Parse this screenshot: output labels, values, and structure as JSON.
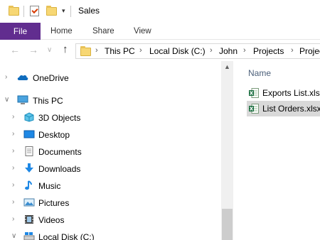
{
  "window": {
    "title": "Sales"
  },
  "quick_access": {
    "icons": [
      "folder-icon",
      "properties-icon",
      "new-folder-icon"
    ],
    "dropdown_glyph": "▾"
  },
  "ribbon": {
    "tabs": [
      "File",
      "Home",
      "Share",
      "View"
    ],
    "file_color": "#612d8f"
  },
  "nav": {
    "back": "←",
    "forward": "→",
    "recent": "∨",
    "up": "↑",
    "breadcrumb": [
      "This PC",
      "Local Disk (C:)",
      "John",
      "Projects",
      "Projec"
    ]
  },
  "tree": [
    {
      "label": "OneDrive",
      "icon": "onedrive-icon",
      "expander": "›"
    },
    {
      "label": "This PC",
      "icon": "computer-icon",
      "expander": "∨"
    },
    {
      "label": "3D Objects",
      "icon": "3d-objects-icon",
      "expander": "›"
    },
    {
      "label": "Desktop",
      "icon": "desktop-icon",
      "expander": "›"
    },
    {
      "label": "Documents",
      "icon": "documents-icon",
      "expander": "›"
    },
    {
      "label": "Downloads",
      "icon": "downloads-icon",
      "expander": "›"
    },
    {
      "label": "Music",
      "icon": "music-icon",
      "expander": "›"
    },
    {
      "label": "Pictures",
      "icon": "pictures-icon",
      "expander": "›"
    },
    {
      "label": "Videos",
      "icon": "videos-icon",
      "expander": "›"
    },
    {
      "label": "Local Disk (C:)",
      "icon": "drive-icon",
      "expander": "∨"
    }
  ],
  "files": {
    "column": "Name",
    "items": [
      {
        "name": "Exports List.xlsx",
        "selected": false
      },
      {
        "name": "List Orders.xlsx",
        "selected": true
      }
    ]
  }
}
